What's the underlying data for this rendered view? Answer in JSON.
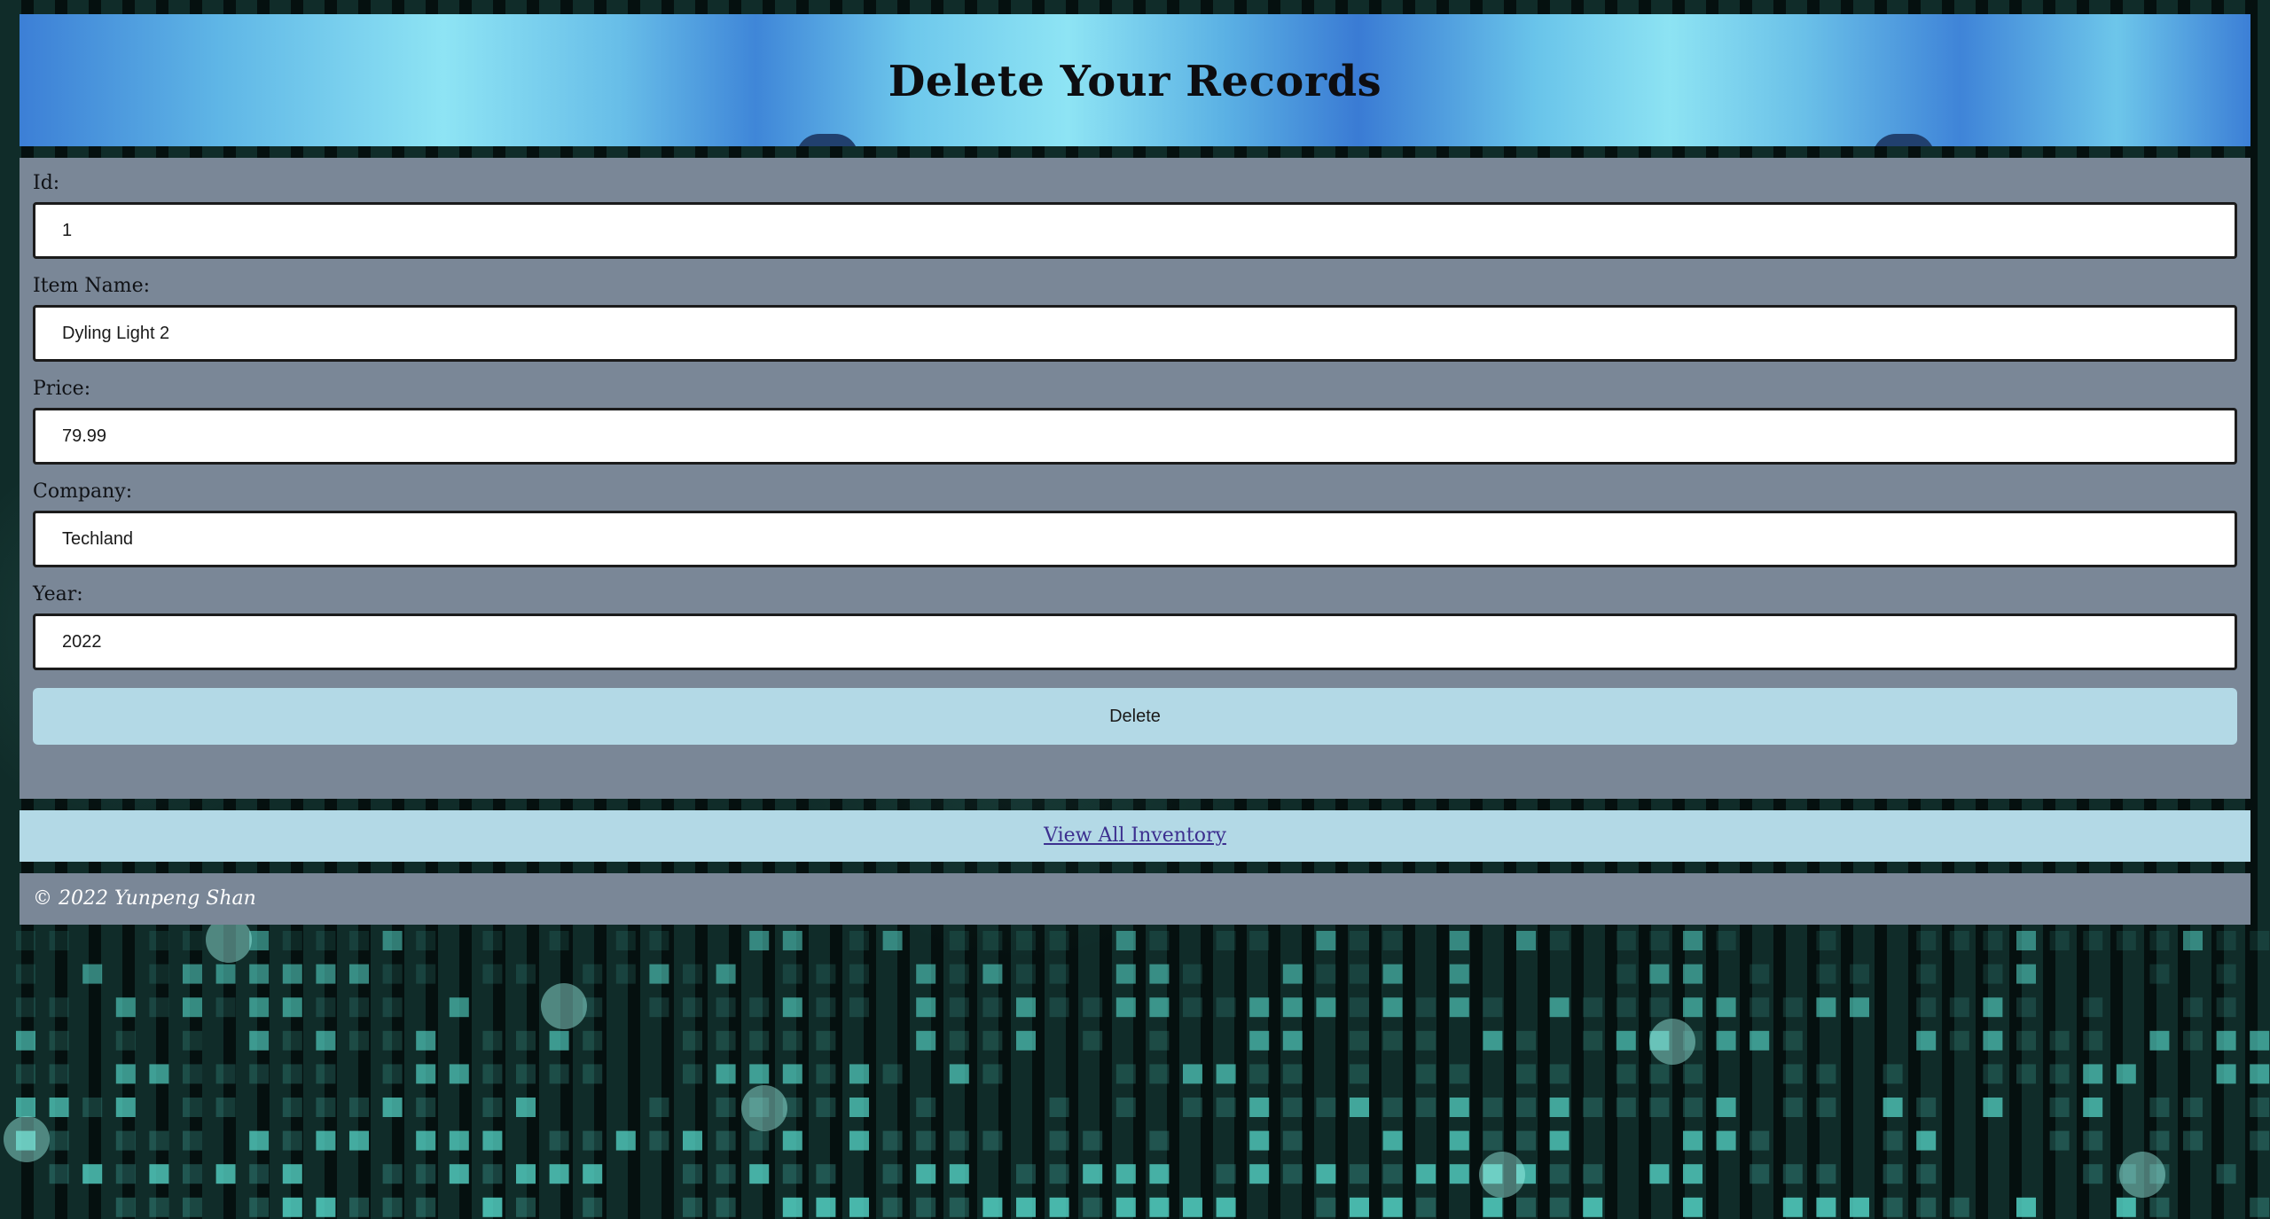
{
  "header": {
    "title": "Delete Your Records"
  },
  "form": {
    "fields": [
      {
        "label": "Id:",
        "value": "1"
      },
      {
        "label": "Item Name:",
        "value": "Dyling Light 2"
      },
      {
        "label": "Price:",
        "value": "79.99"
      },
      {
        "label": "Company:",
        "value": "Techland"
      },
      {
        "label": "Year:",
        "value": "2022"
      }
    ],
    "delete_label": "Delete"
  },
  "nav": {
    "view_all_label": "View All Inventory"
  },
  "footer": {
    "copyright": "© 2022 Yunpeng Shan"
  },
  "colors": {
    "panel": "#7a8797",
    "button": "#b3d9e6",
    "link": "#3c2f8f",
    "background_pixels": "#56d6c8"
  }
}
